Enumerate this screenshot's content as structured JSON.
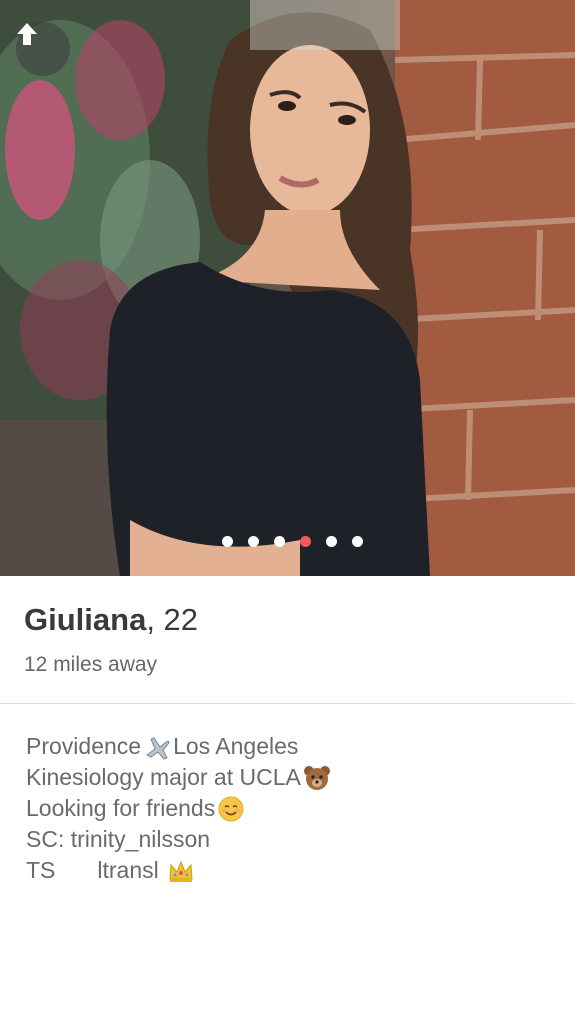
{
  "profile": {
    "name": "Giuliana",
    "age_text": ", 22",
    "distance": "12 miles away"
  },
  "photos": {
    "count": 6,
    "active_index": 3
  },
  "bio": {
    "line1_part1": "Providence",
    "line1_part2": "Los Angeles",
    "line2": "Kinesiology major at UCLA",
    "line3": "Looking for friends ",
    "line4": "SC: trinity_nilsson",
    "line5_part1": "TS",
    "line5_part2": "ltransl"
  },
  "icons": {
    "back": "arrow-up-icon",
    "plane": "airplane-emoji",
    "bear": "bear-emoji",
    "smile": "smiling-face-emoji",
    "crown": "crown-emoji"
  },
  "colors": {
    "active_dot": "#ef5b5b",
    "inactive_dot": "#ffffff"
  }
}
